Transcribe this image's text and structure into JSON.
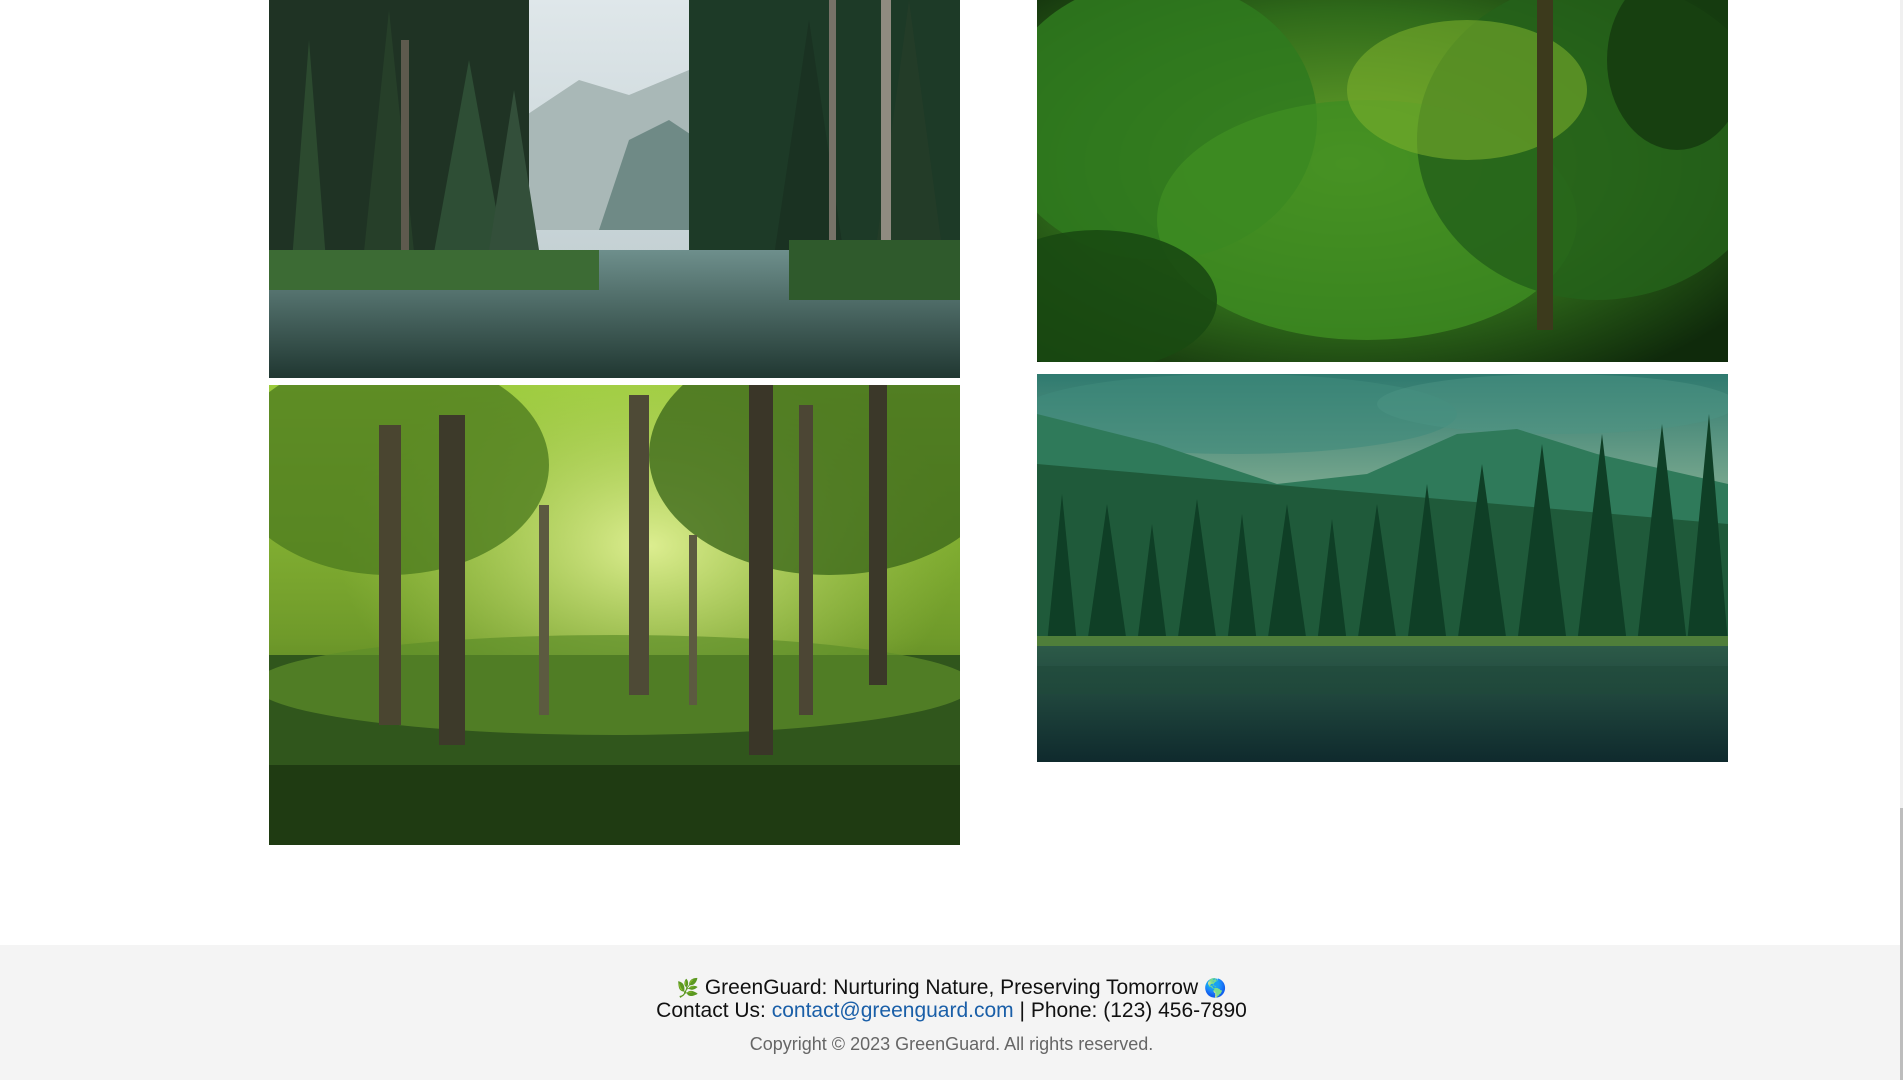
{
  "gallery": {
    "images": [
      {
        "alt": "Mountain river flanked by tall pine forest"
      },
      {
        "alt": "Sunlit green deciduous forest"
      },
      {
        "alt": "Dense lush green jungle"
      },
      {
        "alt": "Lake with evergreen forest and mountains"
      }
    ]
  },
  "footer": {
    "tagline_icon_left": "🌿",
    "tagline": "GreenGuard: Nurturing Nature, Preserving Tomorrow",
    "tagline_icon_right": "🌎",
    "contact_prefix": "Contact Us:",
    "email": "contact@greenguard.com",
    "separator": "|",
    "phone_label": "Phone:",
    "phone": "(123) 456-7890",
    "copyright": "Copyright © 2023 GreenGuard. All rights reserved."
  },
  "colors": {
    "link": "#1a5fa8",
    "footer_bg": "#f4f4f4"
  }
}
